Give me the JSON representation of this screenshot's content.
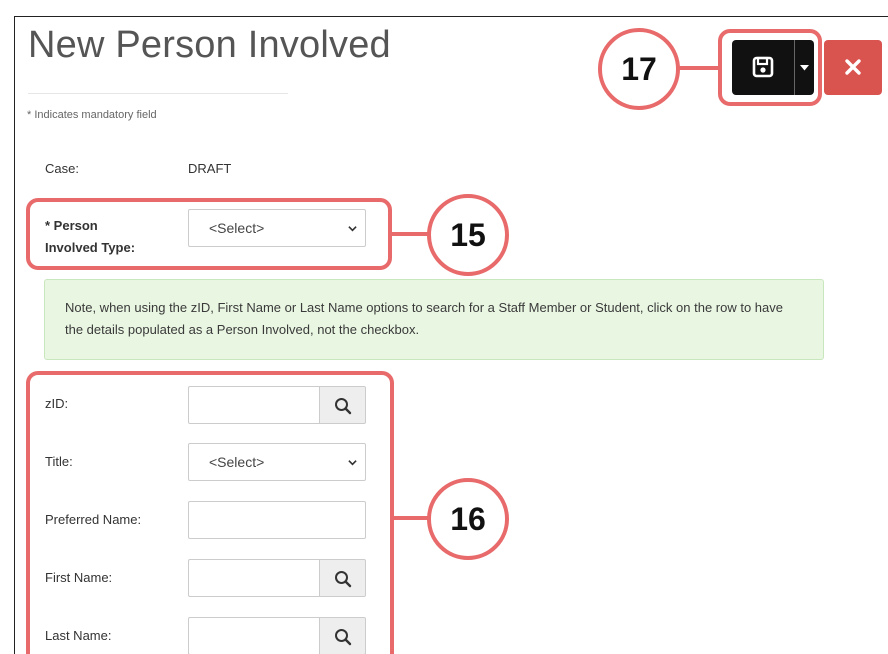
{
  "page": {
    "title": "New Person Involved",
    "mandatory_note": "* Indicates mandatory field"
  },
  "toolbar": {
    "save_icon": "floppy-disk-icon",
    "dropdown_icon": "caret-down-icon",
    "close_icon": "close-icon"
  },
  "case": {
    "label": "Case:",
    "value": "DRAFT"
  },
  "person_type": {
    "label_line1": "* Person",
    "label_line2": "Involved Type:",
    "selected": "<Select>"
  },
  "note": {
    "text": "Note, when using the zID, First Name or Last Name options to search for a Staff Member or Student, click on the row to have the details populated as a Person Involved, not the checkbox."
  },
  "fields": {
    "zid": {
      "label": "zID:",
      "value": ""
    },
    "title": {
      "label": "Title:",
      "selected": "<Select>"
    },
    "preferred_name": {
      "label": "Preferred Name:",
      "value": ""
    },
    "first_name": {
      "label": "First Name:",
      "value": ""
    },
    "last_name": {
      "label": "Last Name:",
      "value": ""
    }
  },
  "annotations": {
    "callout_15": "15",
    "callout_16": "16",
    "callout_17": "17",
    "color": "#e86a6a"
  },
  "colors": {
    "save_button": "#111111",
    "close_button": "#d9534f",
    "note_background": "#e9f6e2"
  }
}
